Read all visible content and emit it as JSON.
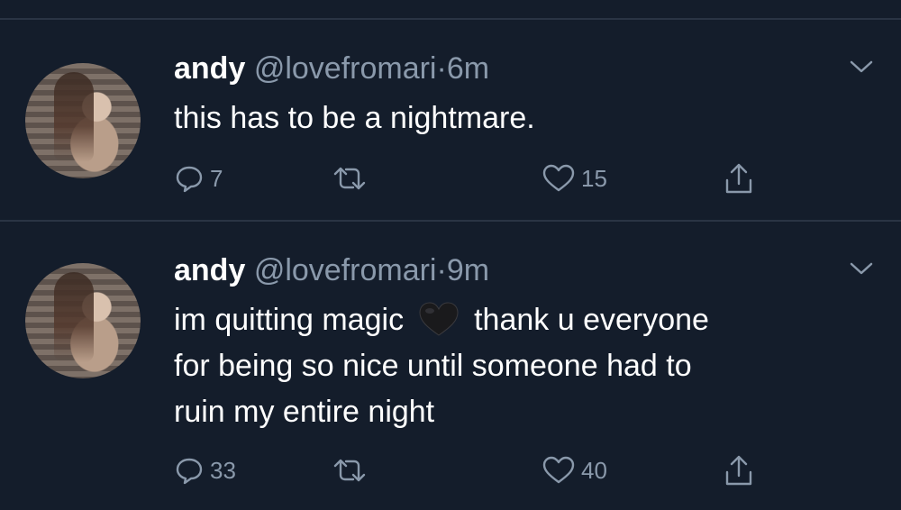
{
  "tweets": [
    {
      "name": "andy",
      "handle": "@lovefromari",
      "dot": "·",
      "time": "6m",
      "text_line1": "this has to be a nightmare.",
      "replies": "7",
      "likes": "15"
    },
    {
      "name": "andy",
      "handle": "@lovefromari",
      "dot": "·",
      "time": "9m",
      "text_line1_a": "im quitting magic",
      "text_line1_b": "thank u everyone",
      "text_line2": "for being so nice until someone had to",
      "text_line3": "ruin my entire night",
      "replies": "33",
      "likes": "40"
    }
  ],
  "icons": {
    "more": "chevron-down-icon",
    "reply": "reply-icon",
    "retweet": "retweet-icon",
    "like": "heart-icon",
    "share": "share-icon",
    "emoji": "black-heart-emoji"
  },
  "colors": {
    "background": "#141d2b",
    "divider": "#2a3444",
    "secondary_text": "#8a99ab",
    "primary_text": "#ffffff"
  }
}
